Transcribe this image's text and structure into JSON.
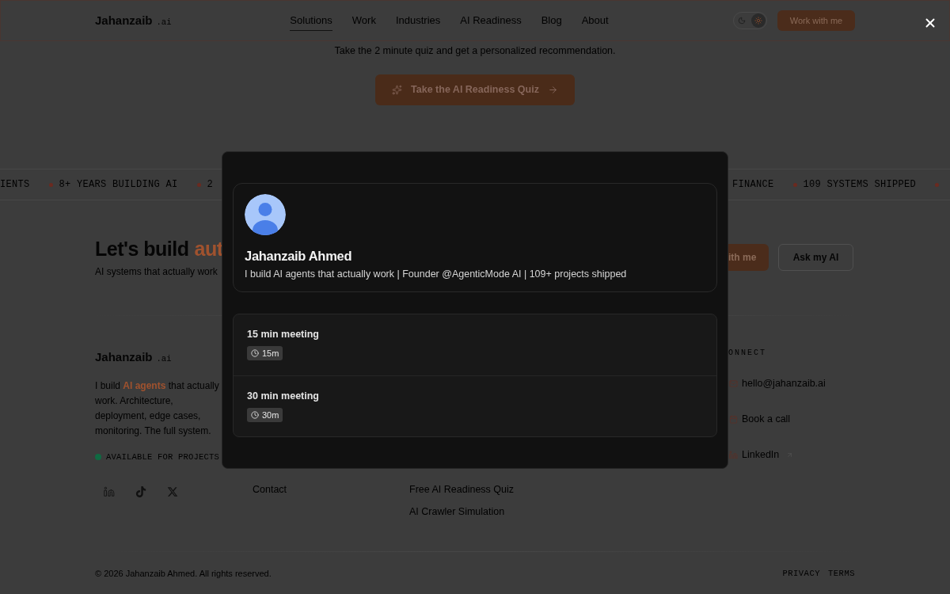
{
  "nav": {
    "logo": {
      "name": "Jahanzaib",
      "suffix": ".ai"
    },
    "links": [
      {
        "label": "Solutions",
        "selected": true
      },
      {
        "label": "Work",
        "selected": false
      },
      {
        "label": "Industries",
        "selected": false
      },
      {
        "label": "AI Readiness",
        "selected": false
      },
      {
        "label": "Blog",
        "selected": false
      },
      {
        "label": "About",
        "selected": false
      }
    ],
    "theme_toggle": [
      {
        "kind": "moon",
        "selected": false
      },
      {
        "kind": "sun",
        "selected": true
      }
    ],
    "cta": "Work with me"
  },
  "hero": {
    "subtitle": "Take the 2 minute quiz and get a personalized recommendation.",
    "button": "Take the AI Readiness Quiz"
  },
  "ticker": {
    "left": [
      {
        "kind": "text",
        "text": "IENTS"
      },
      {
        "kind": "dot"
      },
      {
        "kind": "text",
        "text": "8+ YEARS BUILDING AI"
      },
      {
        "kind": "dot"
      },
      {
        "kind": "text",
        "text": "2"
      }
    ],
    "right": [
      {
        "kind": "text",
        "text": "FINANCE"
      },
      {
        "kind": "dot"
      },
      {
        "kind": "text",
        "text": "109 SYSTEMS SHIPPED"
      },
      {
        "kind": "dot"
      }
    ]
  },
  "cta": {
    "heading": "Let's build",
    "heading_accent": "aut",
    "subtitle": "AI systems that actually work",
    "buttons": [
      {
        "label": "ith me",
        "kind": "primary"
      },
      {
        "label": "Ask my AI",
        "kind": "outline"
      }
    ]
  },
  "footer": {
    "brand": {
      "name": "Jahanzaib",
      "suffix": ".ai"
    },
    "about": "I build **AI agents** that actually work. Architecture, deployment, edge cases, monitoring. The full system.",
    "status": "AVAILABLE FOR PROJECTS",
    "columns": [
      {
        "links": [
          "Contact"
        ]
      },
      {
        "links": [
          "Free AI Readiness Quiz",
          "AI Crawler Simulation"
        ]
      }
    ],
    "connect": {
      "heading": "ONNECT",
      "links": [
        {
          "label": "hello@jahanzaib.ai",
          "kind": "email",
          "external": false
        },
        {
          "label": "Book a call",
          "kind": "calendar",
          "external": false
        },
        {
          "label": "LinkedIn",
          "kind": "linkedin",
          "external": true
        }
      ]
    },
    "copyright": "© 2026 Jahanzaib Ahmed. All rights reserved.",
    "legal": [
      "PRIVACY",
      "TERMS"
    ]
  },
  "modal": {
    "profile": {
      "name": "Jahanzaib Ahmed",
      "bio": "I build AI agents that actually work | Founder @AgenticMode AI | 109+ projects shipped"
    },
    "events": [
      {
        "title": "15 min meeting",
        "duration": "15m"
      },
      {
        "title": "30 min meeting",
        "duration": "30m"
      }
    ]
  }
}
